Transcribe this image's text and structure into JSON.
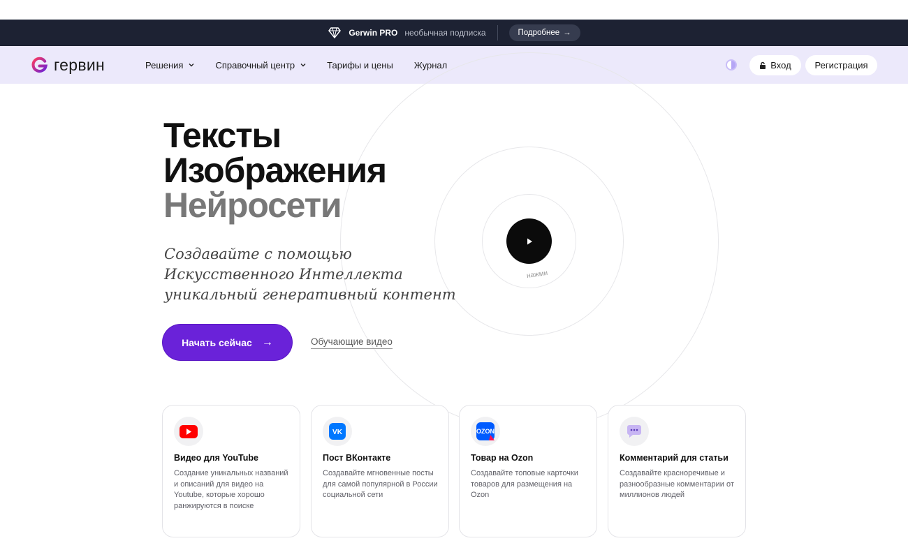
{
  "promo": {
    "brand": "Gerwin PRO",
    "tagline": "необычная подписка",
    "more_label": "Подробнее",
    "gem_icon": "diamond-icon"
  },
  "nav": {
    "logo_text": "гервин",
    "menu": [
      {
        "label": "Решения",
        "has_dropdown": true
      },
      {
        "label": "Справочный центр",
        "has_dropdown": true
      },
      {
        "label": "Тарифы и цены",
        "has_dropdown": false
      },
      {
        "label": "Журнал",
        "has_dropdown": false
      }
    ],
    "login_label": "Вход",
    "register_label": "Регистрация"
  },
  "hero": {
    "line1": "Тексты",
    "line2": "Изображения",
    "line3": "Нейросети",
    "subtitle": "Создавайте с помощью Искусственного Интеллекта уникальный генеративный контент",
    "cta_label": "Начать сейчас",
    "video_link_label": "Обучающие видео",
    "play_hint": "нажми"
  },
  "cards": [
    {
      "title": "Видео для YouTube",
      "desc": "Создание уникальных названий и описаний для видео на Youtube, которые хорошо ранжируются в поиске",
      "icon": "youtube-icon"
    },
    {
      "title": "Пост ВКонтакте",
      "desc": "Создавайте мгновенные посты для самой популярной в России социальной сети",
      "icon": "vk-icon"
    },
    {
      "title": "Товар на Ozon",
      "desc": "Создавайте топовые карточки товаров для размещения на Ozon",
      "icon": "ozon-icon"
    },
    {
      "title": "Комментарий для статьи",
      "desc": "Создавайте красноречивые и разнообразные комментарии от миллионов людей",
      "icon": "comment-icon"
    }
  ],
  "colors": {
    "accent": "#6a22d9",
    "nav_bg": "#ece9fb",
    "promo_bg": "#1d2233"
  }
}
